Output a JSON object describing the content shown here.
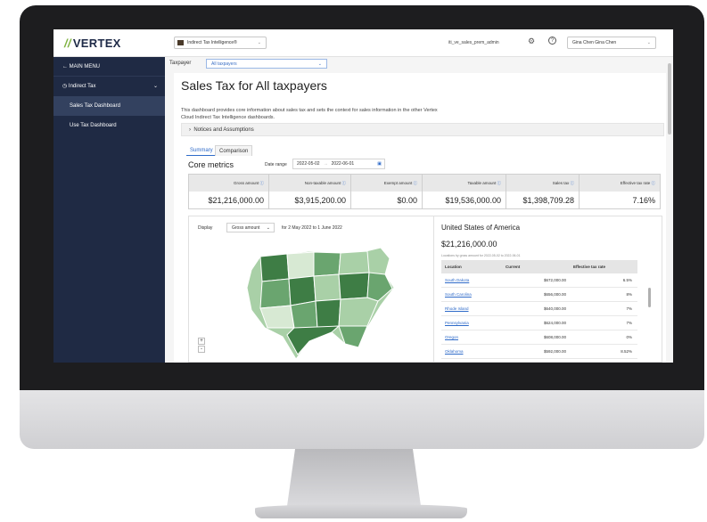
{
  "topbar": {
    "logo": "VERTEX",
    "app_selector": "Indirect Tax Intelligence®",
    "username": "iti_ve_sales_prem_admin",
    "user_selector": "Gina Chen Gina Chen"
  },
  "sidebar": {
    "main_menu": "MAIN MENU",
    "section": "Indirect Tax",
    "items": [
      "Sales Tax Dashboard",
      "Use Tax Dashboard"
    ],
    "active_item": "Sales Tax Dashboard"
  },
  "taxpayer": {
    "label": "Taxpayer",
    "value": "All taxpayers"
  },
  "page": {
    "title": "Sales Tax for All taxpayers",
    "description": "This dashboard provides core information about sales tax and sets the context for sales information in the other Vertex Cloud Indirect Tax Intelligence dashboards.",
    "notices": "Notices and Assumptions",
    "tabs": [
      "Summary",
      "Comparison"
    ],
    "active_tab": "Summary"
  },
  "core_metrics": {
    "title": "Core metrics",
    "date_range_label": "Date range",
    "start_date": "2022-05-02",
    "end_date": "2022-06-01",
    "metrics": [
      {
        "label": "Gross amount",
        "value": "$21,216,000.00"
      },
      {
        "label": "Non-taxable amount",
        "value": "$3,915,200.00"
      },
      {
        "label": "Exempt amount",
        "value": "$0.00"
      },
      {
        "label": "Taxable amount",
        "value": "$19,536,000.00"
      },
      {
        "label": "Sales tax",
        "value": "$1,398,709.28"
      },
      {
        "label": "Effective tax rate",
        "value": "7.16%"
      }
    ]
  },
  "map": {
    "display_label": "Display",
    "display_value": "Gross amount",
    "period": "for 2 May 2022 to 1 June 2022",
    "zoom_in": "+",
    "zoom_out": "-",
    "colors": {
      "dark": "#3e7d45",
      "mid": "#6aa56f",
      "light": "#a9d0a7",
      "pale": "#d7e9d3"
    }
  },
  "detail": {
    "country": "United States of America",
    "total": "$21,216,000.00",
    "subtitle": "Locations by gross amount for 2022-05-02 to 2022-06-01",
    "columns": [
      "Location",
      "Current",
      "Effective tax rate"
    ],
    "rows": [
      {
        "location": "South Dakota",
        "current": "$672,000.00",
        "rate": "6.5%"
      },
      {
        "location": "South Carolina",
        "current": "$656,000.00",
        "rate": "8%"
      },
      {
        "location": "Rhode Island",
        "current": "$640,000.00",
        "rate": "7%"
      },
      {
        "location": "Pennsylvania",
        "current": "$624,000.00",
        "rate": "7%"
      },
      {
        "location": "Oregon",
        "current": "$608,000.00",
        "rate": "0%"
      },
      {
        "location": "Oklahoma",
        "current": "$592,000.00",
        "rate": "8.52%"
      }
    ]
  }
}
